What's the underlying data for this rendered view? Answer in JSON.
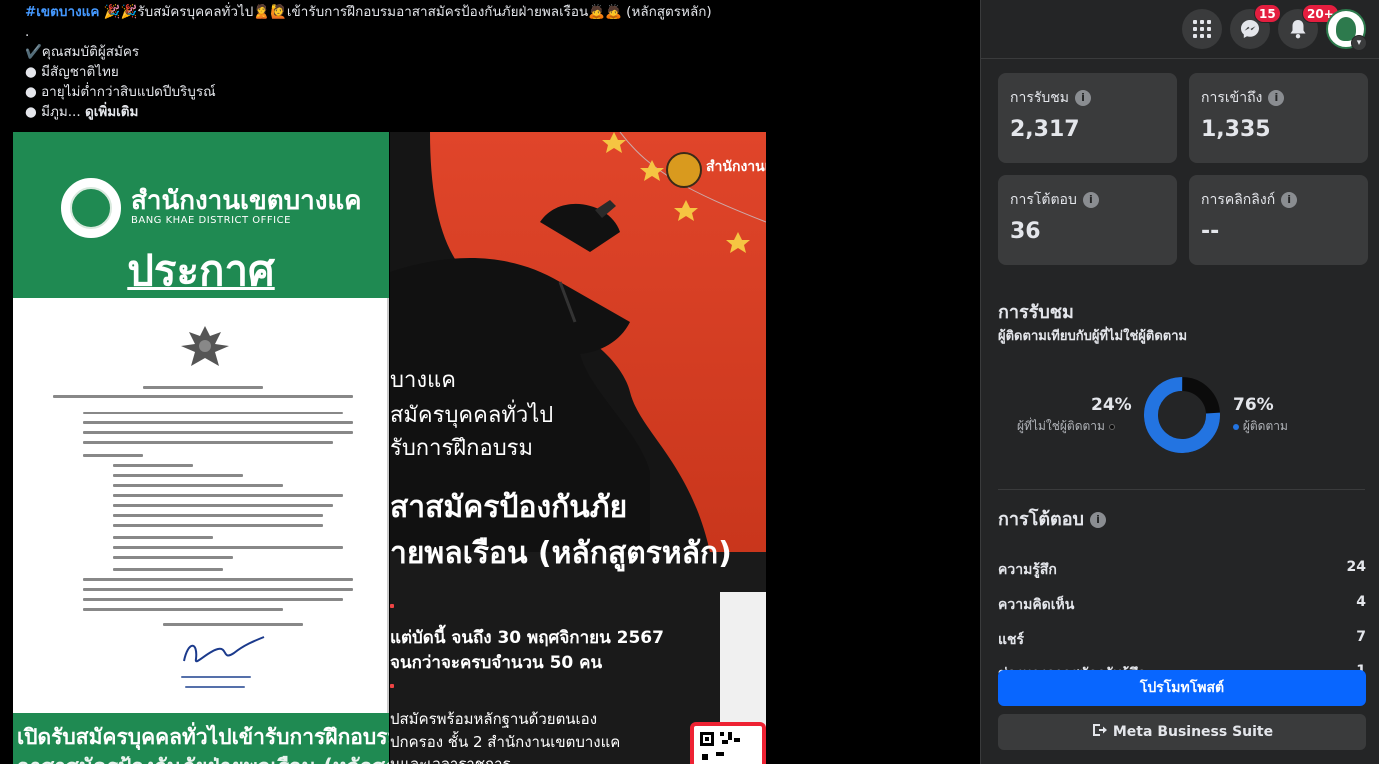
{
  "post": {
    "hashtag": "#เขตบางแค",
    "headline": "🎉🎉รับสมัครบุคคลทั่วไป🙎🙋เข้ารับการฝึกอบรมอาสาสมัครป้องกันภัยฝ่ายพลเรือน🙇🙇 (หลักสูตรหลัก)",
    "dot_line": ".",
    "qual_header": "✔️คุณสมบัติผู้สมัคร",
    "bullets": [
      "● มีสัญชาติไทย",
      "● อายุไม่ต่ำกว่าสิบแปดปีบริบูรณ์",
      "● มีภูม..."
    ],
    "see_more": "ดูเพิ่มเติม"
  },
  "announcement": {
    "office_th": "สำนักงานเขตบางแค",
    "office_en": "BANG KHAE DISTRICT OFFICE",
    "title": "ประกาศ",
    "footer_line1": "เปิดรับสมัครบุคคลทั่วไปเข้ารับการฝึกอบรม",
    "footer_line2": "อาสาสมัครป้องกันภัยฝ่ายพลเรือน (หลักสูตร"
  },
  "poster": {
    "logo_text": "สำนักงานเ",
    "line1": "บางแค",
    "line2": "สมัครบุคคลทั่วไป",
    "line3": "รับการฝึกอบรม",
    "line4": "สาสมัครป้องกันภัย",
    "line5": "ายพลเรือน (หลักสูตรหลัก)",
    "line6": "แต่บัดนี้ จนถึง 30 พฤศจิกายน 2567",
    "line7": "จนกว่าจะครบจำนวน 50 คน",
    "line8": "ปสมัครพร้อมหลักฐานด้วยตนเอง",
    "line9": "ปกครอง ชั้น 2 สำนักงานเขตบางแค",
    "line10": "นและเวลาราชการ"
  },
  "topbar": {
    "menu_icon": "grid-menu-icon",
    "messenger_badge": "15",
    "notifications_badge": "20+"
  },
  "insights": {
    "stats": [
      {
        "label": "การรับชม",
        "value": "2,317"
      },
      {
        "label": "การเข้าถึง",
        "value": "1,335"
      },
      {
        "label": "การโต้ตอบ",
        "value": "36"
      },
      {
        "label": "การคลิกลิงก์",
        "value": "--"
      }
    ],
    "views_title": "การรับชม",
    "views_subtitle": "ผู้ติดตามเทียบกับผู้ที่ไม่ใช่ผู้ติดตาม",
    "non_followers_pct": "24%",
    "non_followers_label": "ผู้ที่ไม่ใช่ผู้ติดตาม",
    "followers_pct": "76%",
    "followers_label": "ผู้ติดตาม",
    "followers_fraction": 0.76,
    "followers_color": "#2374e1",
    "non_followers_color": "#0b0b0b",
    "engagement_title": "การโต้ตอบ",
    "engagement": [
      {
        "label": "ความรู้สึก",
        "value": "24"
      },
      {
        "label": "ความคิดเห็น",
        "value": "4"
      },
      {
        "label": "แชร์",
        "value": "7"
      },
      {
        "label": "ช่องทางการสมัครรับรู้สึก",
        "value": "1"
      }
    ],
    "promote_label": "โปรโมทโพสต์",
    "mbs_label": "Meta Business Suite"
  }
}
